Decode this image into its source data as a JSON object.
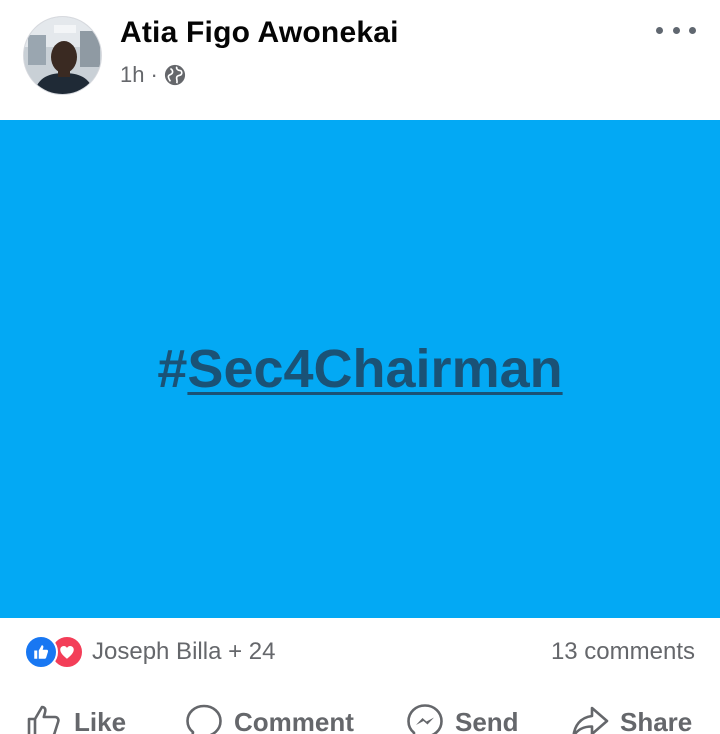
{
  "header": {
    "author_name": "Atia Figo Awonekai",
    "time": "1h",
    "separator": "·",
    "privacy_icon": "globe-icon",
    "more_icon": "more-options-icon"
  },
  "post": {
    "background_color": "#03a9f4",
    "hashtag_symbol": "#",
    "hashtag_text": "Sec4Chairman"
  },
  "reactions": {
    "icons": [
      "like-reaction-icon",
      "love-reaction-icon"
    ],
    "names": "Joseph Billa + 24",
    "comments": "13 comments"
  },
  "actions": {
    "like": "Like",
    "comment": "Comment",
    "send": "Send",
    "share": "Share"
  },
  "colors": {
    "like_blue": "#1877f2",
    "love_red": "#f33e58",
    "secondary_text": "#65676b",
    "hashtag": "#1a5276"
  }
}
